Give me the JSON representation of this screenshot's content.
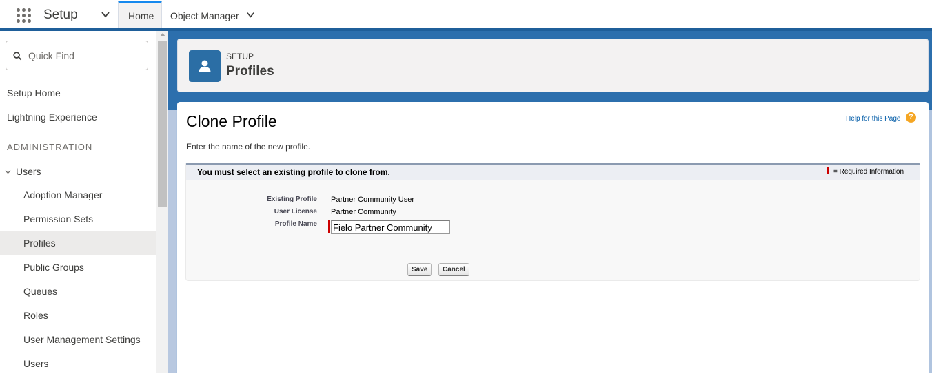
{
  "topbar": {
    "app_name": "Setup",
    "tabs": [
      {
        "label": "Home",
        "active": true
      },
      {
        "label": "Object Manager",
        "active": false
      }
    ]
  },
  "sidebar": {
    "quick_find_placeholder": "Quick Find",
    "items": [
      {
        "label": "Setup Home"
      },
      {
        "label": "Lightning Experience"
      }
    ],
    "section_heading": "ADMINISTRATION",
    "group": {
      "label": "Users",
      "items": [
        {
          "label": "Adoption Manager"
        },
        {
          "label": "Permission Sets"
        },
        {
          "label": "Profiles",
          "active": true
        },
        {
          "label": "Public Groups"
        },
        {
          "label": "Queues"
        },
        {
          "label": "Roles"
        },
        {
          "label": "User Management Settings"
        },
        {
          "label": "Users"
        }
      ]
    }
  },
  "header": {
    "eyebrow": "SETUP",
    "title": "Profiles",
    "icon": "user-icon"
  },
  "content": {
    "page_title": "Clone Profile",
    "help_link": "Help for this Page",
    "help_icon": "?",
    "instructions": "Enter the name of the new profile.",
    "block": {
      "title": "You must select an existing profile to clone from.",
      "required_legend": "= Required Information",
      "fields": [
        {
          "label": "Existing Profile",
          "value": "Partner Community User"
        },
        {
          "label": "User License",
          "value": "Partner Community"
        },
        {
          "label": "Profile Name",
          "value": "Fielo Partner Community"
        }
      ],
      "buttons": {
        "save": "Save",
        "cancel": "Cancel"
      }
    }
  },
  "colors": {
    "brand_blue": "#1f5f9a",
    "required_red": "#cc0000",
    "help_orange": "#f5a623"
  }
}
